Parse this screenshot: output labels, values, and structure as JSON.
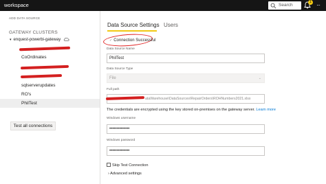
{
  "header": {
    "app_title": "workspace",
    "search_placeholder": "Search",
    "notification_count": "1",
    "more_label": "···"
  },
  "sidebar": {
    "add_source_label": "ADD DATA SOURCE",
    "clusters_heading": "GATEWAY CLUSTERS",
    "gateway_name": "enquest-powerbi-gateway",
    "items": [
      {
        "label": ""
      },
      {
        "label": "CoOrdinates"
      },
      {
        "label": ""
      },
      {
        "label": ""
      },
      {
        "label": "sqlserverupdates"
      },
      {
        "label": "RO's"
      },
      {
        "label": "PhilTest"
      }
    ],
    "test_all_label": "Test all connections"
  },
  "tabs": {
    "settings": "Data Source Settings",
    "users": "Users"
  },
  "form": {
    "connection_status": "Connection Successful",
    "name_label": "Data Source Name",
    "name_value": "PhilTest",
    "type_label": "Data Source Type",
    "type_value": "File",
    "path_label": "Full path",
    "path_value": "ataWarehouse\\DataSources\\RepairOrders\\ROHNumbers2021.xlsx",
    "cred_note": "The credentials are encrypted using the key stored on-premises on the gateway server.",
    "learn_more": "Learn more",
    "username_label": "Windows username",
    "username_value": "••••••••••••••",
    "password_label": "Windows password",
    "password_value": "••••••••••••••",
    "skip_label": "Skip Test Connection",
    "advanced_label": "Advanced settings"
  },
  "colors": {
    "topbar": "#151515",
    "accent_underline": "#f2c811",
    "annotation_red": "#e02020",
    "link": "#0078d4"
  }
}
